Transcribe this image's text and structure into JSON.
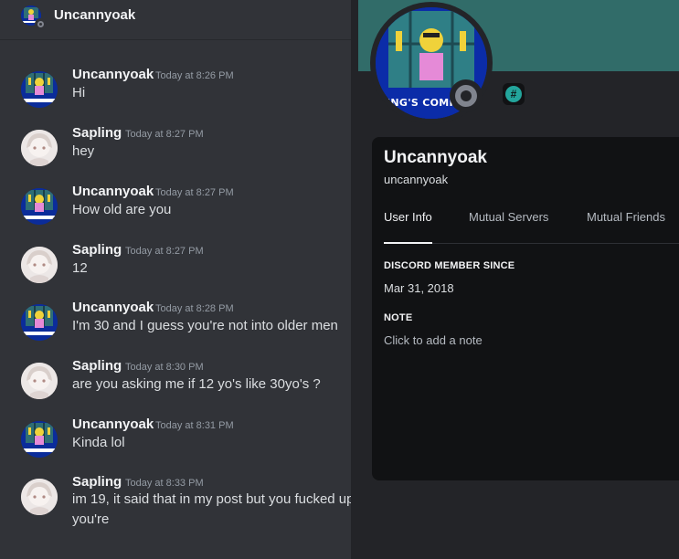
{
  "chat": {
    "header_name": "Uncannyoak",
    "messages": [
      {
        "author": "Uncannyoak",
        "time": "Today at 8:26 PM",
        "text": "Hi"
      },
      {
        "author": "Sapling",
        "time": "Today at 8:27 PM",
        "text": "hey"
      },
      {
        "author": "Uncannyoak",
        "time": "Today at 8:27 PM",
        "text": "How old are you"
      },
      {
        "author": "Sapling",
        "time": "Today at 8:27 PM",
        "text": "12"
      },
      {
        "author": "Uncannyoak",
        "time": "Today at 8:28 PM",
        "text": "I'm 30 and I guess you're not into older men"
      },
      {
        "author": "Sapling",
        "time": "Today at 8:30 PM",
        "text": "are you asking me if 12 yo's like 30yo's ?"
      },
      {
        "author": "Uncannyoak",
        "time": "Today at 8:31 PM",
        "text": "Kinda lol"
      },
      {
        "author": "Sapling",
        "time": "Today at 8:33 PM",
        "text": "im 19, it said that in my post but you fucked up you're"
      }
    ]
  },
  "profile": {
    "display_name": "Uncannyoak",
    "username": "uncannyoak",
    "avatar_caption": "ING'S COMING",
    "badge_icon": "hashtag-badge-icon",
    "tabs": [
      {
        "label": "User Info",
        "active": true
      },
      {
        "label": "Mutual Servers",
        "active": false
      },
      {
        "label": "Mutual Friends",
        "active": false
      }
    ],
    "member_since_title": "DISCORD MEMBER SINCE",
    "member_since": "Mar 31, 2018",
    "note_title": "NOTE",
    "note_placeholder": "Click to add a note"
  },
  "colors": {
    "banner": "#316c69",
    "background": "#313338",
    "card": "#111214",
    "status_offline": "#80848e",
    "badge": "#23a59c"
  }
}
